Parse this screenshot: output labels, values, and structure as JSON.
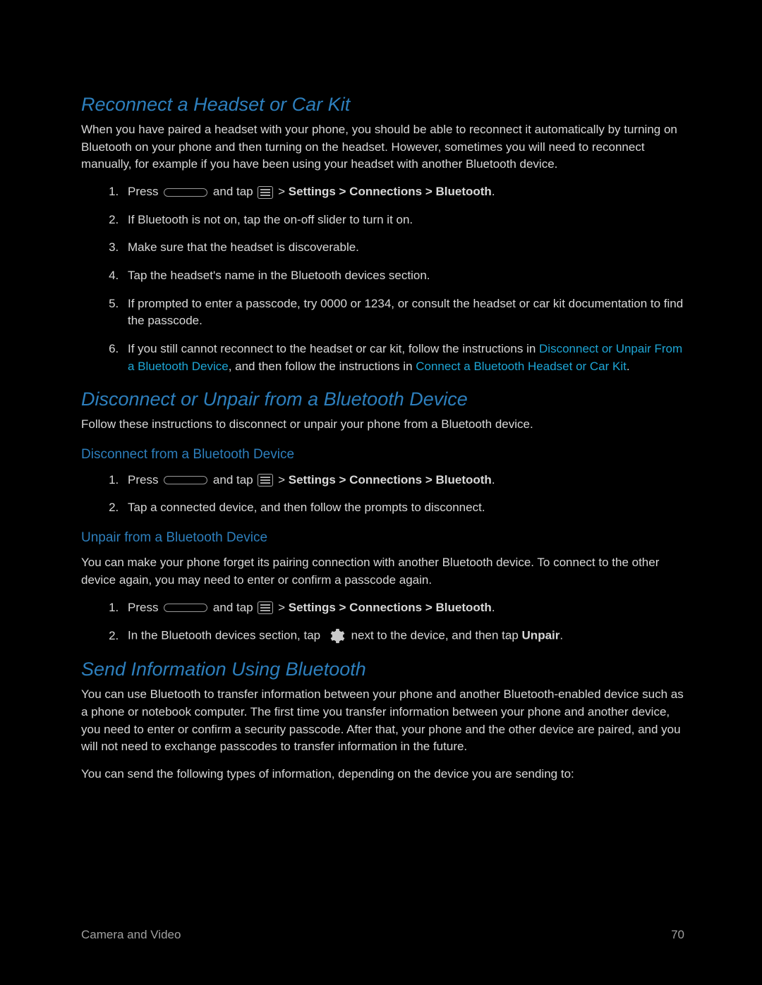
{
  "section1": {
    "title": "Reconnect a Headset or Car Kit",
    "intro": "When you have paired a headset with your phone, you should be able to reconnect it automatically by turning on Bluetooth on your phone and then turning on the headset. However, sometimes you will need to reconnect manually, for example if you have been using your headset with another Bluetooth device.",
    "step1_a": "Press ",
    "step1_b": " and tap ",
    "step1_c": "  >  ",
    "step1_path": "Settings > Connections > Bluetooth",
    "step1_end": ".",
    "step2": "If Bluetooth is not on, tap the on-off slider to turn it on.",
    "step3": "Make sure that the headset is discoverable.",
    "step4": "Tap the headset's name in the Bluetooth devices section.",
    "step5": "If prompted to enter a passcode, try 0000 or 1234, or consult the headset or car kit documentation to find the passcode.",
    "step6_a": "If you still cannot reconnect to the headset or car kit, follow the instructions in ",
    "step6_link1": "Disconnect or Unpair From a Bluetooth Device",
    "step6_b": ", and then follow the instructions in ",
    "step6_link2": "Connect a Bluetooth Headset or Car Kit",
    "step6_c": "."
  },
  "section2": {
    "title": "Disconnect or Unpair from a Bluetooth Device",
    "intro": "Follow these instructions to disconnect or unpair your phone from a Bluetooth device.",
    "sub1_title": "Disconnect from a Bluetooth Device",
    "sub1_step1_a": "Press ",
    "sub1_step1_b": " and tap ",
    "sub1_step1_c": "  >  ",
    "sub1_step1_path": "Settings > Connections > Bluetooth",
    "sub1_step1_end": ".",
    "sub1_step2": "Tap a connected device, and then follow the prompts to disconnect.",
    "sub2_title": "Unpair from a Bluetooth Device",
    "sub2_intro": "You can make your phone forget its pairing connection with another Bluetooth device. To connect to the other device again, you may need to enter or confirm a passcode again.",
    "sub2_step1_a": "Press ",
    "sub2_step1_b": " and tap ",
    "sub2_step1_c": "  >  ",
    "sub2_step1_path": "Settings > Connections > Bluetooth",
    "sub2_step1_end": ".",
    "sub2_step2_a": "In the Bluetooth devices section, tap ",
    "sub2_step2_b": " next to the device, and then tap ",
    "sub2_step2_c": "Unpair",
    "sub2_step2_d": "."
  },
  "section3": {
    "title": "Send Information Using Bluetooth",
    "para1": "You can use Bluetooth to transfer information between your phone and another Bluetooth-enabled device such as a phone or notebook computer. The first time you transfer information between your phone and another device, you need to enter or confirm a security passcode. After that, your phone and the other device are paired, and you will not need to exchange passcodes to transfer information in the future.",
    "para2": "You can send the following types of information, depending on the device you are sending to:"
  },
  "footer": {
    "left": "Camera and Video",
    "right": "70"
  }
}
